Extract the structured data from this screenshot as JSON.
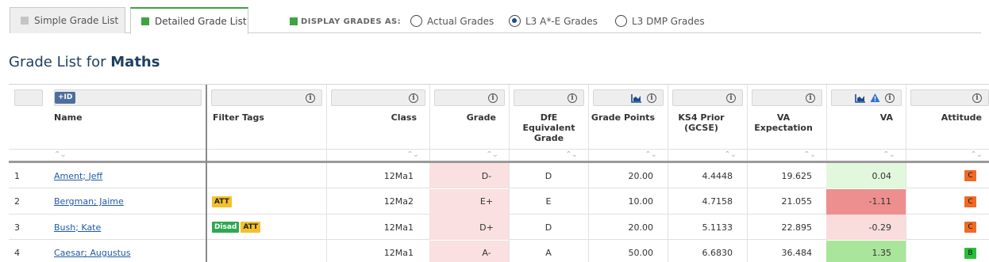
{
  "tabs": [
    {
      "label": "Simple Grade List",
      "active": false
    },
    {
      "label": "Detailed Grade List",
      "active": true
    }
  ],
  "display_as": {
    "label": "DISPLAY GRADES AS:",
    "options": [
      {
        "label": "Actual Grades",
        "selected": false
      },
      {
        "label": "L3 A*-E Grades",
        "selected": true
      },
      {
        "label": "L3 DMP Grades",
        "selected": false
      }
    ]
  },
  "page_title": {
    "prefix": "Grade List for ",
    "subject": "Maths"
  },
  "table": {
    "id_tag": "+ID",
    "headers": {
      "name": "Name",
      "filter_tags": "Filter Tags",
      "class": "Class",
      "grade": "Grade",
      "dfe": "DfE Equivalent Grade",
      "grade_points": "Grade Points",
      "ks4": "KS4 Prior (GCSE)",
      "va_expectation": "VA Expectation",
      "va": "VA",
      "attitude": "Attitude"
    },
    "rows": [
      {
        "num": "1",
        "name": "Ament; Jeff",
        "tags": [],
        "class": "12Ma1",
        "grade": "D-",
        "dfe": "D",
        "points": "20.00",
        "ks4": "4.4448",
        "va_exp": "19.625",
        "va": "0.04",
        "attitude": "C"
      },
      {
        "num": "2",
        "name": "Bergman; Jaime",
        "tags": [
          {
            "text": "ATT",
            "color": "#f2c12e"
          }
        ],
        "class": "12Ma2",
        "grade": "E+",
        "dfe": "E",
        "points": "10.00",
        "ks4": "4.7158",
        "va_exp": "21.055",
        "va": "-1.11",
        "attitude": "C"
      },
      {
        "num": "3",
        "name": "Bush; Kate",
        "tags": [
          {
            "text": "Disad",
            "color": "#2fa84f"
          },
          {
            "text": "ATT",
            "color": "#f2c12e"
          }
        ],
        "class": "12Ma1",
        "grade": "D+",
        "dfe": "D",
        "points": "20.00",
        "ks4": "5.1133",
        "va_exp": "22.895",
        "va": "-0.29",
        "attitude": "C"
      },
      {
        "num": "4",
        "name": "Caesar; Augustus",
        "tags": [],
        "class": "12Ma1",
        "grade": "A-",
        "dfe": "A",
        "points": "50.00",
        "ks4": "6.6830",
        "va_exp": "36.484",
        "va": "1.35",
        "attitude": "B"
      }
    ]
  },
  "colors": {
    "accent_green": "#3fa33f",
    "grade_bg": "#fae0e0",
    "va_bgs": [
      "#e2f8dc",
      "#ee8f8f",
      "#f9dcdc",
      "#a9e59a"
    ],
    "attitude_c": "#ef6a25",
    "attitude_b": "#2bbd3a"
  }
}
